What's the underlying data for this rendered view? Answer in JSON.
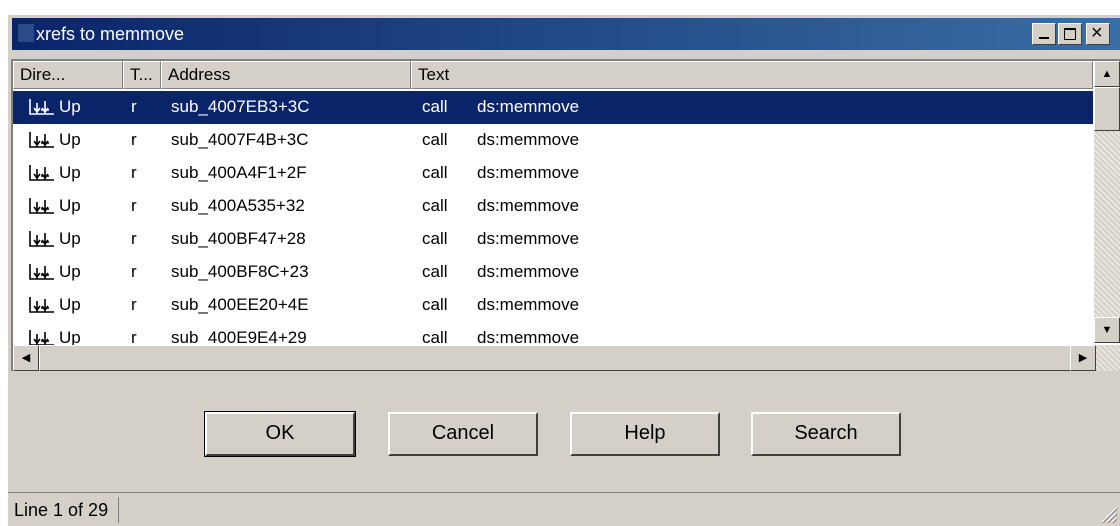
{
  "window": {
    "title": "xrefs to memmove",
    "controls": {
      "minimize": "minimize",
      "maximize": "maximize",
      "close": "close"
    }
  },
  "list": {
    "columns": [
      {
        "label": "Dire..."
      },
      {
        "label": "T..."
      },
      {
        "label": "Address"
      },
      {
        "label": "Text"
      }
    ],
    "rows": [
      {
        "direction": "Up",
        "type": "r",
        "address": "sub_4007EB3+3C",
        "mnemonic": "call",
        "operand": "ds:memmove",
        "selected": true
      },
      {
        "direction": "Up",
        "type": "r",
        "address": "sub_4007F4B+3C",
        "mnemonic": "call",
        "operand": "ds:memmove"
      },
      {
        "direction": "Up",
        "type": "r",
        "address": "sub_400A4F1+2F",
        "mnemonic": "call",
        "operand": "ds:memmove"
      },
      {
        "direction": "Up",
        "type": "r",
        "address": "sub_400A535+32",
        "mnemonic": "call",
        "operand": "ds:memmove"
      },
      {
        "direction": "Up",
        "type": "r",
        "address": "sub_400BF47+28",
        "mnemonic": "call",
        "operand": "ds:memmove"
      },
      {
        "direction": "Up",
        "type": "r",
        "address": "sub_400BF8C+23",
        "mnemonic": "call",
        "operand": "ds:memmove"
      },
      {
        "direction": "Up",
        "type": "r",
        "address": "sub_400EE20+4E",
        "mnemonic": "call",
        "operand": "ds:memmove"
      },
      {
        "direction": "Up",
        "type": "r",
        "address": "sub_400E9E4+29",
        "mnemonic": "call",
        "operand": "ds:memmove"
      }
    ]
  },
  "buttons": {
    "ok": "OK",
    "cancel": "Cancel",
    "help": "Help",
    "search": "Search"
  },
  "status": {
    "text": "Line 1 of 29"
  },
  "colors": {
    "title_bar": "#0a246a",
    "selection": "#0a246a",
    "face": "#d4d0c8"
  }
}
